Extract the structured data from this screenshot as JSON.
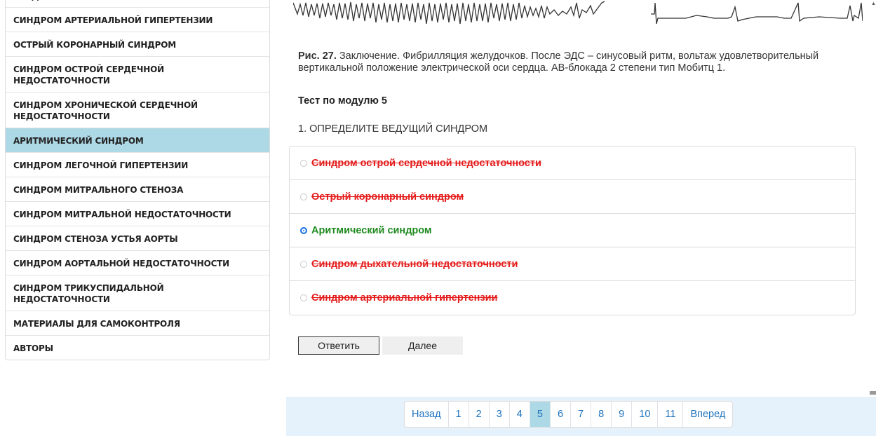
{
  "sidebar": {
    "items": [
      {
        "label": "ВВЕДЕНИЕ",
        "active": false
      },
      {
        "label": "СИНДРОМ АРТЕРИАЛЬНОЙ ГИПЕРТЕНЗИИ",
        "active": false
      },
      {
        "label": "ОСТРЫЙ КОРОНАРНЫЙ СИНДРОМ",
        "active": false
      },
      {
        "label": "СИНДРОМ ОСТРОЙ СЕРДЕЧНОЙ НЕДОСТАТОЧНОСТИ",
        "active": false
      },
      {
        "label": "СИНДРОМ ХРОНИЧЕСКОЙ СЕРДЕЧНОЙ НЕДОСТАТОЧНОСТИ",
        "active": false
      },
      {
        "label": "АРИТМИЧЕСКИЙ СИНДРОМ",
        "active": true
      },
      {
        "label": "СИНДРОМ ЛЕГОЧНОЙ ГИПЕРТЕНЗИИ",
        "active": false
      },
      {
        "label": "СИНДРОМ МИТРАЛЬНОГО СТЕНОЗА",
        "active": false
      },
      {
        "label": "СИНДРОМ МИТРАЛЬНОЙ НЕДОСТАТОЧНОСТИ",
        "active": false
      },
      {
        "label": "СИНДРОМ СТЕНОЗА УСТЬЯ АОРТЫ",
        "active": false
      },
      {
        "label": "СИНДРОМ АОРТАЛЬНОЙ НЕДОСТАТОЧНОСТИ",
        "active": false
      },
      {
        "label": "СИНДРОМ ТРИКУСПИДАЛЬНОЙ НЕДОСТАТОЧНОСТИ",
        "active": false
      },
      {
        "label": "МАТЕРИАЛЫ ДЛЯ САМОКОНТРОЛЯ",
        "active": false
      },
      {
        "label": "АВТОРЫ",
        "active": false
      }
    ]
  },
  "content": {
    "caption_label": "Рис. 27.",
    "caption_text": " Заключение. Фибрилляция желудочков. После ЭДС – синусовый ритм, вольтаж удовлетворительный вертикальной положение электрической оси сердца. АВ-блокада 2 степени тип Мобитц 1.",
    "test_title": "Тест по модулю 5",
    "question": "1. ОПРЕДЕЛИТЕ ВЕДУЩИЙ СИНДРОМ",
    "answers": [
      {
        "text": "Синдром острой сердечной недостаточности",
        "state": "wrong",
        "checked": false
      },
      {
        "text": "Острый коронарный синдром",
        "state": "wrong",
        "checked": false
      },
      {
        "text": "Аритмический синдром",
        "state": "right",
        "checked": true
      },
      {
        "text": "Синдром дыхательной недостаточности",
        "state": "wrong",
        "checked": false
      },
      {
        "text": "Синдром артериальной гипертензии",
        "state": "wrong",
        "checked": false
      }
    ],
    "answer_button": "Ответить",
    "next_button": "Далее"
  },
  "pagination": {
    "prev": "Назад",
    "pages": [
      "1",
      "2",
      "3",
      "4",
      "5",
      "6",
      "7",
      "8",
      "9",
      "10",
      "11"
    ],
    "active_page": "5",
    "next": "Вперед"
  },
  "icons": {
    "scroll_up": "scroll-up-arrow-icon"
  },
  "colors": {
    "active_bg": "#add8e6",
    "wrong": "#e41b1b",
    "right": "#1e8a1e",
    "link": "#1e73be",
    "pager_bar_bg": "#e5f1fb"
  }
}
